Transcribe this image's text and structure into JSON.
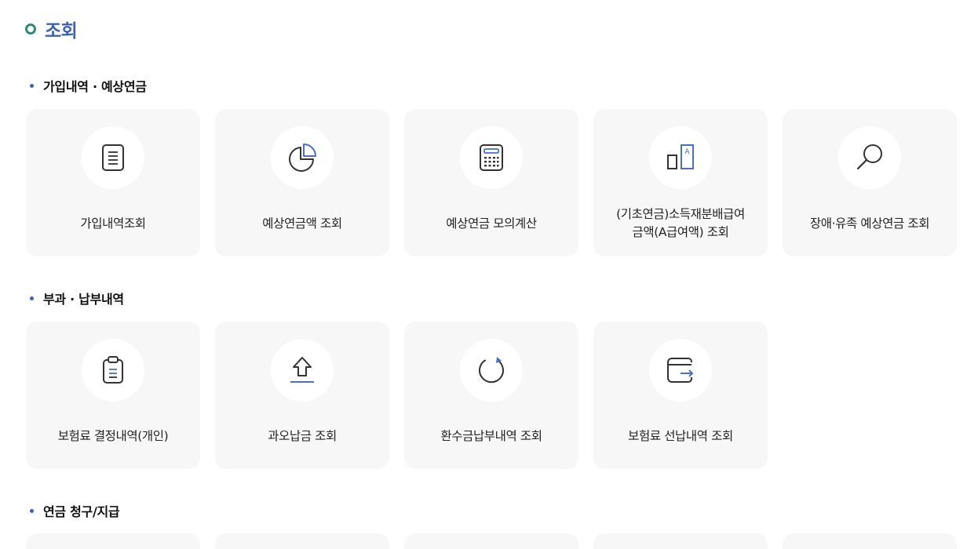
{
  "page": {
    "title": "조회"
  },
  "sections": [
    {
      "title": "가입내역 · 예상연금",
      "cards": [
        {
          "label": "가입내역조회",
          "icon": "document-list-icon"
        },
        {
          "label": "예상연금액 조회",
          "icon": "pie-chart-icon"
        },
        {
          "label": "예상연금 모의계산",
          "icon": "calculator-icon"
        },
        {
          "label": "(기초연금)소득재분배급여\n금액(A급여액) 조회",
          "icon": "bar-a-icon"
        },
        {
          "label": "장애·유족 예상연금 조회",
          "icon": "magnifier-icon"
        }
      ]
    },
    {
      "title": "부과 · 납부내역",
      "cards": [
        {
          "label": "보험료 결정내역(개인)",
          "icon": "clipboard-icon"
        },
        {
          "label": "과오납금 조회",
          "icon": "upload-arrow-icon"
        },
        {
          "label": "환수금납부내역 조회",
          "icon": "refresh-circle-icon"
        },
        {
          "label": "보험료 선납내역 조회",
          "icon": "wallet-icon"
        }
      ]
    },
    {
      "title": "연금 청구/지급",
      "cards": []
    }
  ],
  "colors": {
    "title": "#3d63b0",
    "title_bullet": "#2e8b7a",
    "section_dot": "#3d63b0",
    "icon_stroke": "#333333",
    "icon_accent": "#4a6fc4",
    "card_bg": "#f7f7f7"
  }
}
